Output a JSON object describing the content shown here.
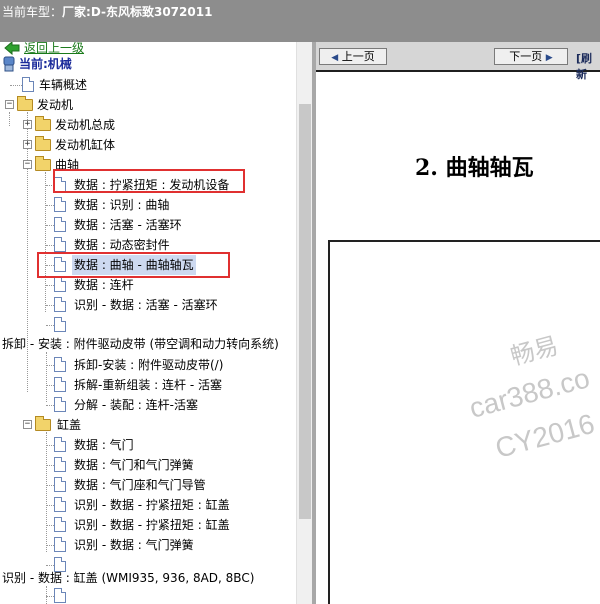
{
  "titlebar": {
    "label": "当前车型：",
    "value": "厂家:D-东风标致3072011"
  },
  "tree": {
    "back": "返回上一级",
    "current": "当前:机械",
    "items": [
      "车辆概述",
      "发动机",
      "发动机总成",
      "发动机缸体",
      "曲轴",
      "数据 : 拧紧扭矩 : 发动机设备",
      "数据 : 识别 : 曲轴",
      "数据 : 活塞 - 活塞环",
      "数据 : 动态密封件",
      "数据 : 曲轴 - 曲轴轴瓦",
      "数据 : 连杆",
      "识别 - 数据 : 活塞 - 活塞环",
      "拆卸 - 安装 : 附件驱动皮带 (带空调和动力转向系统)",
      "拆卸-安装 : 附件驱动皮带(/)",
      "拆解-重新组装 : 连杆 - 活塞",
      "分解 - 装配 : 连杆-活塞",
      "缸盖",
      "数据 : 气门",
      "数据 : 气门和气门弹簧",
      "数据 : 气门座和气门导管",
      "识别 - 数据 - 拧紧扭矩 : 缸盖",
      "识别 - 数据 - 拧紧扭矩 : 缸盖",
      "识别 - 数据 : 气门弹簧",
      "识别 - 数据 : 缸盖 (WMI935, 936, 8AD, 8BC)"
    ]
  },
  "viewer": {
    "prev": "上一页",
    "next": "下一页",
    "refresh": "[刷新",
    "heading": "2. 曲轴轴瓦",
    "watermark": [
      "畅易",
      "car388.co",
      "CY2016"
    ]
  }
}
